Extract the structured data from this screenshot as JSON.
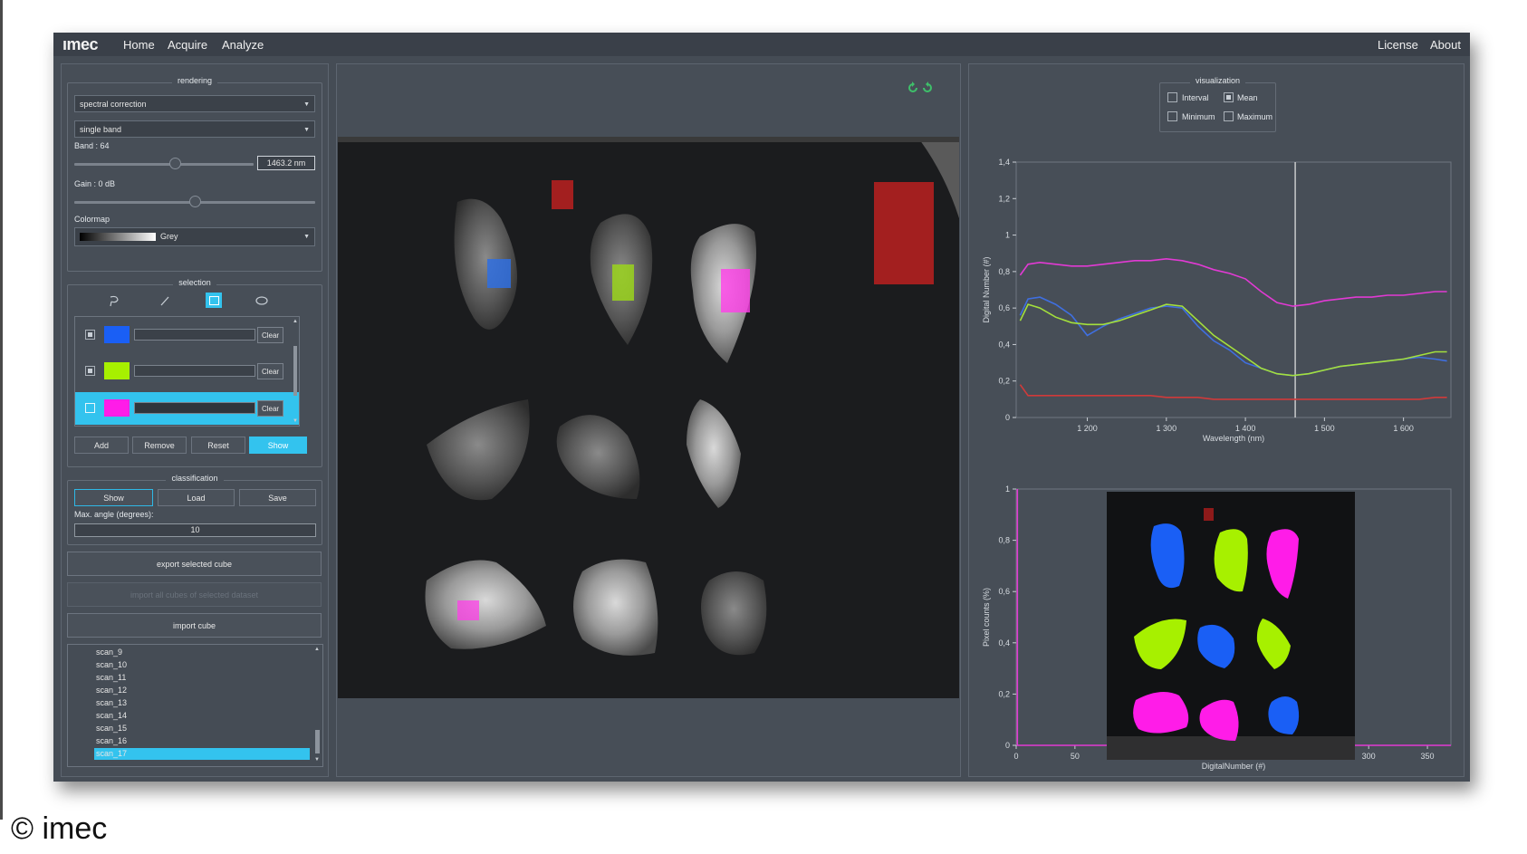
{
  "app": {
    "logo": "ımec"
  },
  "nav": {
    "home": "Home",
    "acquire": "Acquire",
    "analyze": "Analyze",
    "license": "License",
    "about": "About"
  },
  "rendering": {
    "title": "rendering",
    "mode": "spectral correction",
    "band_mode": "single band",
    "band_label": "Band : 64",
    "band_value": 0.56,
    "band_nm": "1463.2 nm",
    "gain_label": "Gain : 0 dB",
    "gain_value": 0.5,
    "colormap_label": "Colormap",
    "colormap": "Grey"
  },
  "selection": {
    "title": "selection",
    "rows": [
      {
        "color": "#1a5ff5",
        "clear": "Clear"
      },
      {
        "color": "#a7f000",
        "clear": "Clear"
      },
      {
        "color": "#ff1ce8",
        "clear": "Clear"
      }
    ],
    "add": "Add",
    "remove": "Remove",
    "reset": "Reset",
    "show": "Show"
  },
  "classification": {
    "title": "classification",
    "show": "Show",
    "load": "Load",
    "save": "Save",
    "angle_label": "Max. angle (degrees):",
    "angle_value": "10"
  },
  "actions": {
    "export_selected": "export selected cube",
    "import_all": "import all cubes of selected dataset",
    "import_cube": "import cube"
  },
  "scans": [
    "scan_9",
    "scan_10",
    "scan_11",
    "scan_12",
    "scan_13",
    "scan_14",
    "scan_15",
    "scan_16",
    "scan_17"
  ],
  "visualization": {
    "title": "visualization",
    "interval": "Interval",
    "mean": "Mean",
    "minimum": "Minimum",
    "maximum": "Maximum"
  },
  "colors": {
    "blue": "#1a5ff5",
    "green": "#a7f000",
    "magenta": "#ff1ce8",
    "red": "#cc2b2b",
    "accent": "#33c3ee"
  },
  "chart_data": [
    {
      "type": "line",
      "xlabel": "Wavelength (nm)",
      "ylabel": "Digital Number (#)",
      "xlim": [
        1110,
        1660
      ],
      "ylim": [
        0,
        1.4
      ],
      "xticks": [
        {
          "v": 1200,
          "t": "1 200"
        },
        {
          "v": 1300,
          "t": "1 300"
        },
        {
          "v": 1400,
          "t": "1 400"
        },
        {
          "v": 1500,
          "t": "1 500"
        },
        {
          "v": 1600,
          "t": "1 600"
        }
      ],
      "yticks": [
        {
          "v": 0,
          "t": "0"
        },
        {
          "v": 0.2,
          "t": "0,2"
        },
        {
          "v": 0.4,
          "t": "0,4"
        },
        {
          "v": 0.6,
          "t": "0,6"
        },
        {
          "v": 0.8,
          "t": "0,8"
        },
        {
          "v": 1,
          "t": "1"
        },
        {
          "v": 1.2,
          "t": "1,2"
        },
        {
          "v": 1.4,
          "t": "1,4"
        }
      ],
      "cursor_x": 1463,
      "x": [
        1115,
        1125,
        1140,
        1160,
        1180,
        1200,
        1220,
        1240,
        1260,
        1280,
        1300,
        1320,
        1340,
        1360,
        1380,
        1400,
        1420,
        1440,
        1460,
        1480,
        1500,
        1520,
        1540,
        1560,
        1580,
        1600,
        1620,
        1640,
        1655
      ],
      "series": [
        {
          "color": "#e23ad4",
          "values": [
            0.78,
            0.84,
            0.85,
            0.84,
            0.83,
            0.83,
            0.84,
            0.85,
            0.86,
            0.86,
            0.87,
            0.86,
            0.84,
            0.81,
            0.79,
            0.76,
            0.69,
            0.63,
            0.61,
            0.62,
            0.64,
            0.65,
            0.66,
            0.66,
            0.67,
            0.67,
            0.68,
            0.69,
            0.69
          ]
        },
        {
          "color": "#3f6fe0",
          "values": [
            0.56,
            0.65,
            0.66,
            0.62,
            0.56,
            0.45,
            0.5,
            0.54,
            0.57,
            0.6,
            0.61,
            0.6,
            0.5,
            0.42,
            0.37,
            0.3,
            0.27,
            0.24,
            0.23,
            0.24,
            0.26,
            0.28,
            0.29,
            0.3,
            0.31,
            0.32,
            0.33,
            0.32,
            0.31
          ]
        },
        {
          "color": "#a4e03c",
          "values": [
            0.53,
            0.62,
            0.6,
            0.55,
            0.52,
            0.51,
            0.51,
            0.53,
            0.56,
            0.59,
            0.62,
            0.61,
            0.53,
            0.45,
            0.39,
            0.33,
            0.27,
            0.24,
            0.23,
            0.24,
            0.26,
            0.28,
            0.29,
            0.3,
            0.31,
            0.32,
            0.34,
            0.36,
            0.36
          ]
        },
        {
          "color": "#d13a3a",
          "values": [
            0.18,
            0.12,
            0.12,
            0.12,
            0.12,
            0.12,
            0.12,
            0.12,
            0.12,
            0.12,
            0.11,
            0.11,
            0.11,
            0.1,
            0.1,
            0.1,
            0.1,
            0.1,
            0.1,
            0.1,
            0.1,
            0.1,
            0.1,
            0.1,
            0.1,
            0.1,
            0.1,
            0.11,
            0.11
          ]
        }
      ]
    },
    {
      "type": "line",
      "xlabel": "DigitalNumber (#)",
      "ylabel": "Pixel counts (%)",
      "xlim": [
        0,
        370
      ],
      "ylim": [
        0,
        1
      ],
      "xticks": [
        {
          "v": 0,
          "t": "0"
        },
        {
          "v": 50,
          "t": "50"
        },
        {
          "v": 100,
          "t": "100"
        },
        {
          "v": 150,
          "t": "150"
        },
        {
          "v": 200,
          "t": "200"
        },
        {
          "v": 250,
          "t": "250"
        },
        {
          "v": 300,
          "t": "300"
        },
        {
          "v": 350,
          "t": "350"
        }
      ],
      "yticks": [
        {
          "v": 0,
          "t": "0"
        },
        {
          "v": 0.2,
          "t": "0,2"
        },
        {
          "v": 0.4,
          "t": "0,4"
        },
        {
          "v": 0.6,
          "t": "0,6"
        },
        {
          "v": 0.8,
          "t": "0,8"
        },
        {
          "v": 1,
          "t": "1"
        }
      ],
      "x": [
        1,
        1,
        370
      ],
      "series": [
        {
          "color": "#e23ad4",
          "values": [
            1,
            0,
            0
          ]
        }
      ]
    }
  ]
}
